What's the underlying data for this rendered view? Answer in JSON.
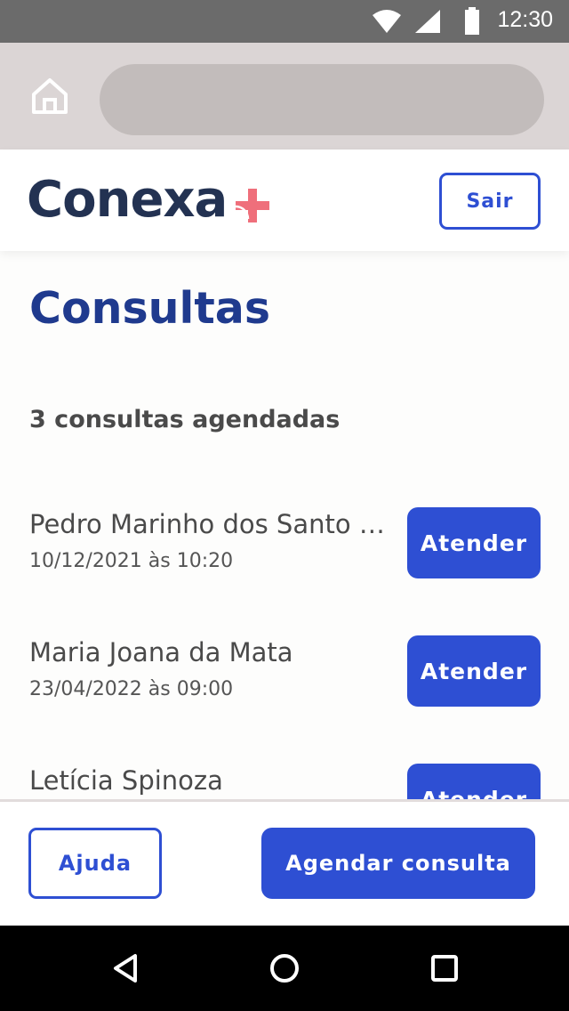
{
  "status_bar": {
    "time": "12:30",
    "icons": [
      "wifi-icon",
      "cell-signal-icon",
      "battery-icon"
    ]
  },
  "browser": {
    "home_icon": "home-icon",
    "url": ""
  },
  "header": {
    "logo_text": "Conexa",
    "logo_icon": "medical-cross-signal-icon",
    "logout_label": "Sair"
  },
  "page": {
    "title": "Consultas",
    "count_label": "3 consultas agendadas"
  },
  "appointments": [
    {
      "patient": "Pedro Marinho dos Santo l...",
      "datetime": "10/12/2021 às 10:20",
      "action": "Atender"
    },
    {
      "patient": "Maria Joana da Mata",
      "datetime": "23/04/2022 às 09:00",
      "action": "Atender"
    },
    {
      "patient": "Letícia Spinoza",
      "datetime": "",
      "action": "Atender"
    }
  ],
  "footer": {
    "help_label": "Ajuda",
    "schedule_label": "Agendar consulta"
  },
  "nav": {
    "icons": [
      "back-icon",
      "home-circle-icon",
      "recents-icon"
    ]
  },
  "colors": {
    "primary": "#2e4fd3",
    "title": "#1f3a8e",
    "logo_text": "#233252",
    "logo_accent": "#ef6f7b"
  }
}
